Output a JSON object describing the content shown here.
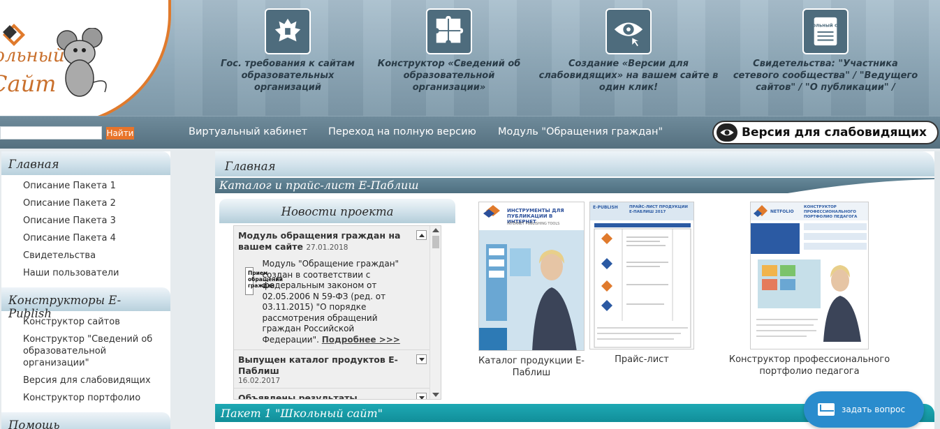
{
  "header": {
    "logo_line1": "Школьный",
    "logo_line2": "Сайт",
    "features": [
      {
        "icon": "coat-of-arms-icon",
        "caption": "Гос. требования к сайтам образовательных организаций"
      },
      {
        "icon": "puzzle-icon",
        "caption": "Конструктор «Сведений об образовательной организации»"
      },
      {
        "icon": "eye-icon",
        "caption": "Создание «Версии для слабовидящих» на вашем сайте в один клик!"
      },
      {
        "icon": "certificate-icon",
        "caption": "Свидетельства: \"Участника сетевого сообщества\" / \"Ведущего сайтов\" / \"О публикации\" /"
      }
    ],
    "certificate_badge": "школьный сайт"
  },
  "nav": {
    "search_placeholder": "",
    "search_button": "Найти",
    "links": [
      "Виртуальный кабинет",
      "Переход на полную версию",
      "Модуль \"Обращения граждан\""
    ],
    "vision_button": "Версия для слабовидящих"
  },
  "sidebar": {
    "sections": [
      {
        "title": "Главная",
        "items": [
          "Описание Пакета 1",
          "Описание Пакета 2",
          "Описание Пакета 3",
          "Описание Пакета 4",
          "Свидетельства",
          "Наши пользователи"
        ]
      },
      {
        "title": "Конструкторы E-Publish",
        "items": [
          "Конструктор сайтов",
          "Конструктор \"Сведений об образовательной организации\"",
          "Версия для слабовидящих",
          "Конструктор портфолио"
        ]
      },
      {
        "title": "Помощь",
        "items": []
      }
    ]
  },
  "main": {
    "title": "Главная",
    "catalog_title": "Каталог и прайс-лист Е-Паблиш",
    "news": {
      "title": "Новости проекта",
      "items": [
        {
          "title": "Модуль обращения граждан на вашем сайте",
          "date": "27.01.2018",
          "thumb_text": "Прием обращений граждан",
          "text": "Модуль \"Обращение граждан\" создан в соответствии с федеральным законом от 02.05.2006 N 59-ФЗ (ред. от 03.11.2015) \"О порядке рассмотрения обращений граждан Российской Федерации\".",
          "more": "Подробнее >>>"
        },
        {
          "title": "Выпущен каталог продуктов Е-Паблиш",
          "date": "16.02.2017"
        },
        {
          "title": "Объявлены результаты Всероссийского",
          "date": ""
        }
      ]
    },
    "cards": [
      {
        "caption": "Каталог продукции Е-Паблиш",
        "img_title": "ИНСТРУМЕНТЫ ДЛЯ ПУБЛИКАЦИИ В ИНТЕРНЕТ",
        "img_sub": "INTERNET PUBLISHING TOOLS"
      },
      {
        "caption": "Прайс-лист",
        "img_title": "ПРАЙС-ЛИСТ ПРОДУКЦИИ Е-ПАБЛИШ 2017",
        "img_sub": "E-PUBLISH"
      },
      {
        "caption": "Конструктор профессионального портфолио педагога",
        "img_title": "КОНСТРУКТОР ПРОФЕССИОНАЛЬНОГО ПОРТФОЛИО ПЕДАГОГА",
        "img_sub": "NETFOLIO"
      }
    ],
    "paket_title": "Пакет 1 \"Школьный сайт\""
  },
  "ask": {
    "label": "задать вопрос"
  },
  "colors": {
    "accent": "#e8742a",
    "nav_bg": "#5e7a8a",
    "teal": "#17a0ab",
    "ask": "#2a8ccd"
  }
}
